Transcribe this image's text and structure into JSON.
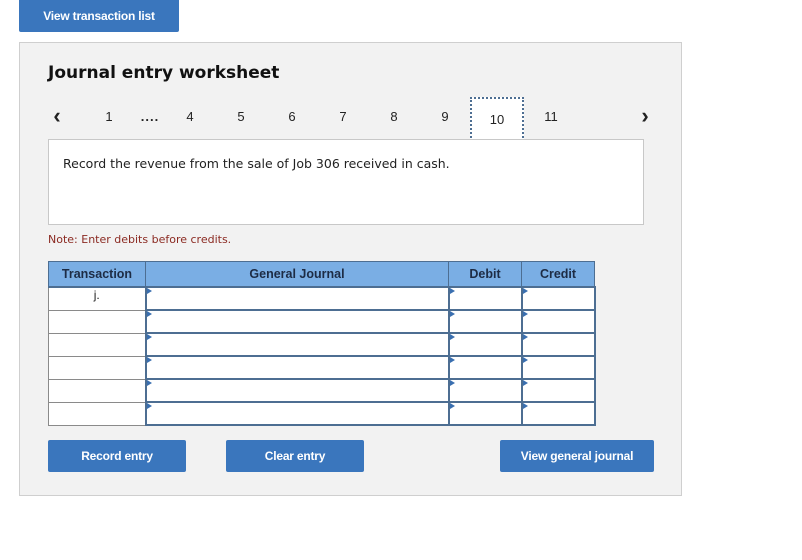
{
  "top_button": "View transaction list",
  "title": "Journal entry worksheet",
  "pager": {
    "prev_icon": "‹",
    "next_icon": "›",
    "pages": [
      "1",
      "....",
      "4",
      "5",
      "6",
      "7",
      "8",
      "9",
      "10",
      "11"
    ],
    "active": "10"
  },
  "description": "Record the revenue from the sale of Job 306 received in cash.",
  "note": "Note: Enter debits before credits.",
  "table": {
    "headers": [
      "Transaction",
      "General Journal",
      "Debit",
      "Credit"
    ],
    "rows": [
      {
        "transaction": "j.",
        "account": "",
        "debit": "",
        "credit": ""
      },
      {
        "transaction": "",
        "account": "",
        "debit": "",
        "credit": ""
      },
      {
        "transaction": "",
        "account": "",
        "debit": "",
        "credit": ""
      },
      {
        "transaction": "",
        "account": "",
        "debit": "",
        "credit": ""
      },
      {
        "transaction": "",
        "account": "",
        "debit": "",
        "credit": ""
      },
      {
        "transaction": "",
        "account": "",
        "debit": "",
        "credit": ""
      }
    ]
  },
  "buttons": {
    "record": "Record entry",
    "clear": "Clear entry",
    "view_general_journal": "View general journal"
  }
}
